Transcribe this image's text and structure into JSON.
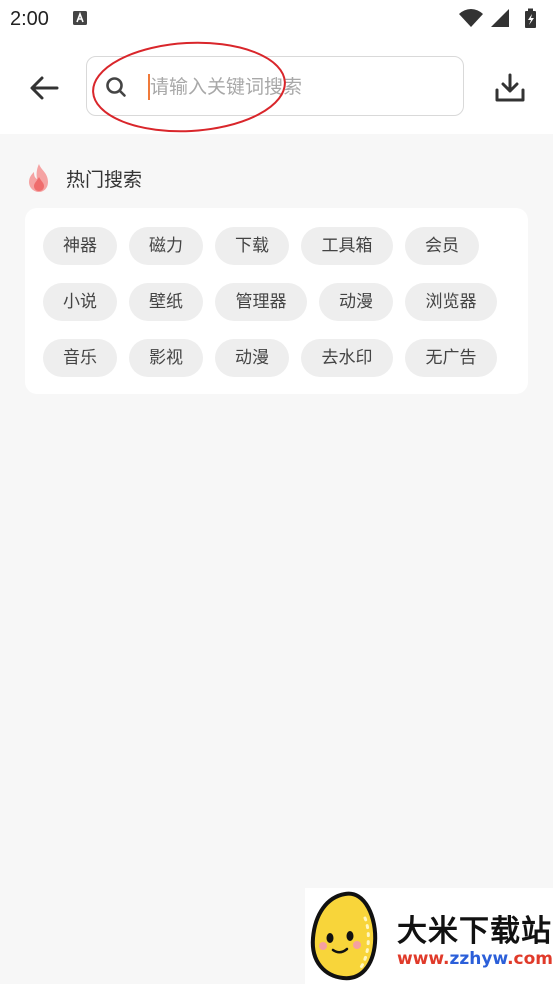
{
  "status_bar": {
    "time": "2:00",
    "icons": [
      "a-notification-icon",
      "wifi-icon",
      "signal-icon",
      "battery-charging-icon"
    ]
  },
  "header": {
    "back_icon": "back-arrow-icon",
    "search": {
      "icon": "search-icon",
      "placeholder": "请输入关键词搜索",
      "value": ""
    },
    "download_icon": "download-icon"
  },
  "hot_search": {
    "icon": "fire-icon",
    "title": "热门搜索",
    "tags": [
      "神器",
      "磁力",
      "下载",
      "工具箱",
      "会员",
      "小说",
      "壁纸",
      "管理器",
      "动漫",
      "浏览器",
      "音乐",
      "影视",
      "动漫",
      "去水印",
      "无广告"
    ]
  },
  "watermark": {
    "title": "大米下载站",
    "url_prefix": "www.",
    "url_domain": "zzhyw",
    "url_suffix": ".com"
  },
  "colors": {
    "accent_caret": "#f07a3a",
    "annotation_red": "#d9262b",
    "fire": "#f27e7e",
    "tag_bg": "#eeeeee",
    "page_bg": "#f7f7f7"
  }
}
